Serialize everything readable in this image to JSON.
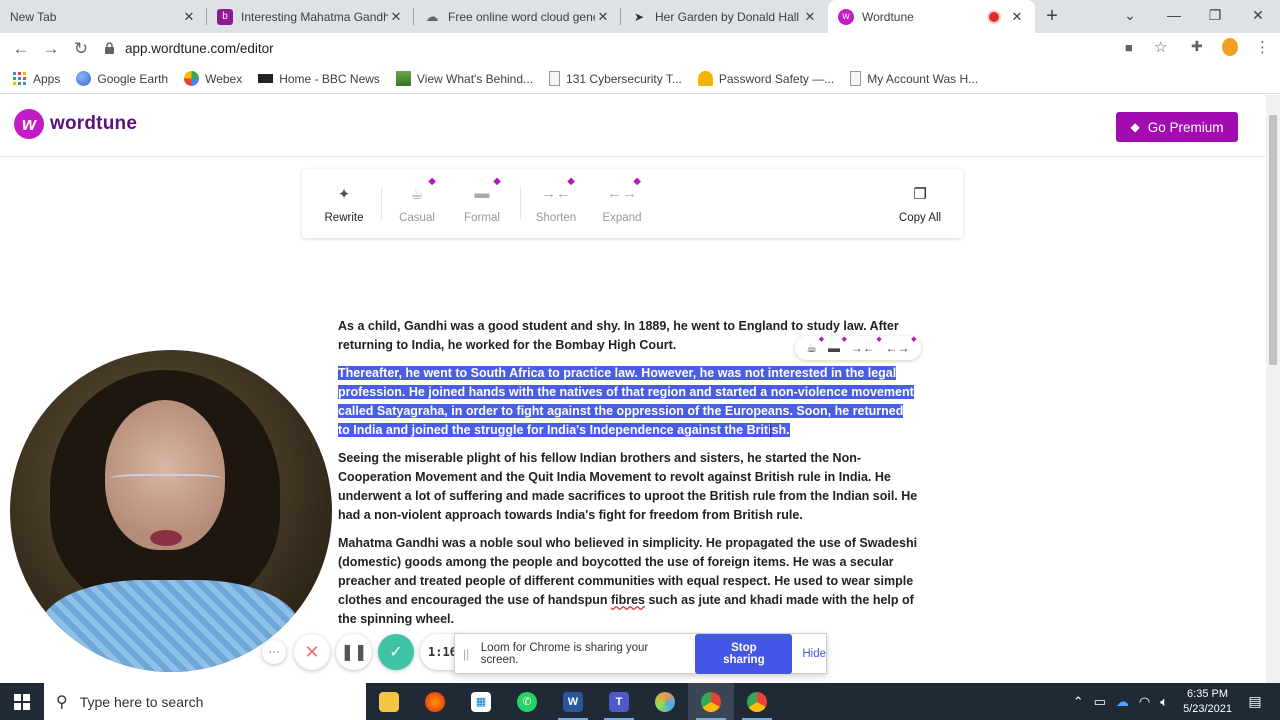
{
  "browser": {
    "tabs": [
      {
        "title": "New Tab",
        "favicon": "none",
        "active": false
      },
      {
        "title": "Interesting Mahatma Gandhi",
        "favicon": "b-icon",
        "active": false
      },
      {
        "title": "Free online word cloud gener",
        "favicon": "cloud-icon",
        "active": false
      },
      {
        "title": "Her Garden by Donald Hall | P",
        "favicon": "bird-icon",
        "active": false
      },
      {
        "title": "Wordtune",
        "favicon": "wordtune-icon",
        "active": true,
        "recording": true
      }
    ],
    "new_tab_symbol": "+",
    "url": "app.wordtune.com/editor",
    "bookmarks": [
      {
        "label": "Apps",
        "icon": "apps-grid-icon"
      },
      {
        "label": "Google Earth",
        "icon": "earth-icon"
      },
      {
        "label": "Webex",
        "icon": "webex-icon"
      },
      {
        "label": "Home - BBC News",
        "icon": "bbc-icon"
      },
      {
        "label": "View What's Behind...",
        "icon": "image-icon"
      },
      {
        "label": "131 Cybersecurity T...",
        "icon": "doc-icon"
      },
      {
        "label": "Password Safety —...",
        "icon": "house-icon"
      },
      {
        "label": "My Account Was H...",
        "icon": "doc-icon"
      }
    ]
  },
  "app": {
    "name": "wordtune",
    "logo_letter": "w",
    "premium_label": "Go Premium",
    "brand_color": "#a10bb0",
    "toolbar": {
      "rewrite": "Rewrite",
      "casual": "Casual",
      "formal": "Formal",
      "shorten": "Shorten",
      "expand": "Expand",
      "copy_all": "Copy All"
    },
    "paragraphs": {
      "p1": "As a child, Gandhi was a good student and shy. In 1889, he went to England to study law. After returning to India, he worked for the Bombay High Court.",
      "p2": "Thereafter, he went to South Africa to practice law. However, he was not interested in the legal profession. He joined hands with the natives of that region and started a non-violence movement called Satyagraha, in order to fight against the oppression of the Europeans. Soon, he returned to India and joined the struggle for India's Independence against the British.",
      "p3": "Seeing the miserable plight of his fellow Indian brothers and sisters, he started the Non-Cooperation Movement and the Quit India Movement to revolt against British rule in India. He underwent a lot of suffering and made sacrifices to uproot the British rule from the Indian soil. He had a non-violent approach towards India's fight for freedom from British rule.",
      "p4_before": "Mahatma Gandhi was a noble soul who believed in simplicity. He propagated the use of Swadeshi (domestic) goods among the people and boycotted the use of foreign items. He was a secular preacher and treated people of different communities with equal respect. He used to wear simple clothes and encouraged the use of handspun ",
      "p4_misspelled": "fibres",
      "p4_after": " such as jute and khadi made with the help of the spinning wheel."
    },
    "highlight_color": "#4a5de8"
  },
  "loom": {
    "timer": "1:16",
    "more_symbol": "···",
    "sharing_text": "Loom for Chrome is sharing your screen.",
    "stop_label": "Stop sharing",
    "hide_label": "Hide"
  },
  "taskbar": {
    "search_placeholder": "Type here to search",
    "time": "6:35 PM",
    "date": "5/23/2021",
    "apps": [
      "file-explorer-icon",
      "firefox-icon",
      "store-icon",
      "whatsapp-icon",
      "word-icon",
      "teams-icon",
      "paint-icon",
      "chrome-icon",
      "chrome-icon"
    ]
  }
}
